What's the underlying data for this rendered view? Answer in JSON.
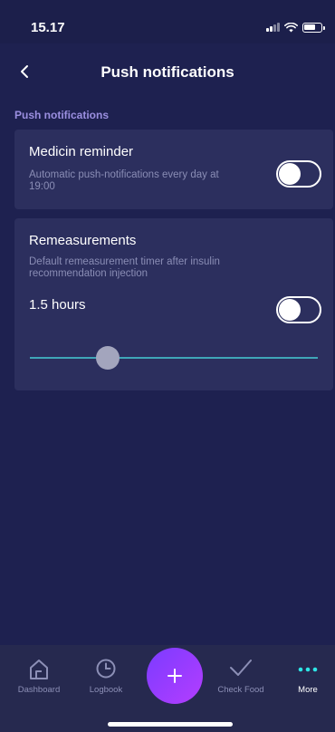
{
  "status_bar": {
    "time": "15.17"
  },
  "nav": {
    "title": "Push notifications"
  },
  "section": {
    "label": "Push notifications"
  },
  "medicin": {
    "title": "Medicin reminder",
    "description_line1": "Automatic push-notifications every day at",
    "description_line2": "19:00",
    "enabled": false
  },
  "remeasurements": {
    "title": "Remeasurements",
    "description_line1": "Default remeasurement timer after insulin",
    "description_line2": "recommendation injection",
    "hours_label": "1.5 hours",
    "enabled": false,
    "slider_fraction": 0.27
  },
  "tabs": [
    {
      "label": "Dashboard",
      "icon": "home-icon"
    },
    {
      "label": "Logbook",
      "icon": "clock-icon"
    },
    {
      "label": "Check Food",
      "icon": "check-icon"
    },
    {
      "label": "More",
      "icon": "more-dots-icon"
    }
  ],
  "add_button": {
    "icon": "plus-icon"
  },
  "colors": {
    "background": "#1e2150",
    "card": "#2c2f5e",
    "accent_purple": "#9b8fe0",
    "slider_track": "#3fa6b8",
    "more_dots": "#2ee6e6",
    "add_gradient_start": "#7b3cff",
    "add_gradient_end": "#b43dff"
  }
}
